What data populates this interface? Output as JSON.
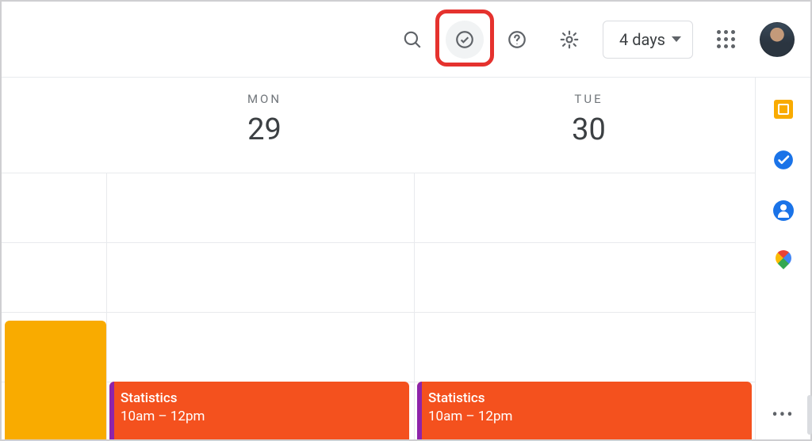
{
  "header": {
    "view_label": "4 days"
  },
  "days": [
    {
      "dow": "MON",
      "num": "29"
    },
    {
      "dow": "TUE",
      "num": "30"
    }
  ],
  "events": [
    {
      "title": "Statistics",
      "time": "10am – 12pm"
    },
    {
      "title": "Statistics",
      "time": "10am – 12pm"
    }
  ]
}
